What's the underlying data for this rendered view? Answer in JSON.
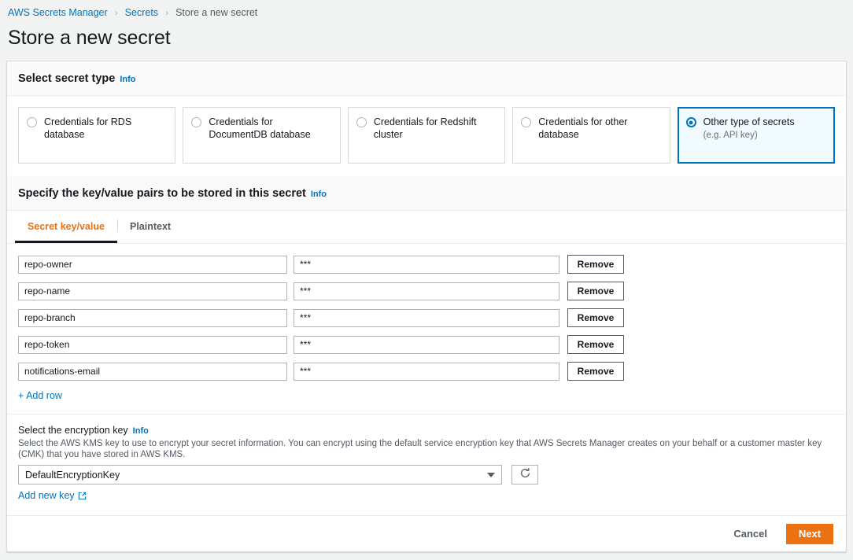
{
  "breadcrumb": {
    "items": [
      {
        "label": "AWS Secrets Manager",
        "current": false
      },
      {
        "label": "Secrets",
        "current": false
      },
      {
        "label": "Store a new secret",
        "current": true
      }
    ],
    "separator": "›"
  },
  "page": {
    "title": "Store a new secret"
  },
  "secret_type": {
    "heading": "Select secret type",
    "info_label": "Info",
    "options": [
      {
        "label": "Credentials for RDS database",
        "sublabel": "",
        "selected": false
      },
      {
        "label": "Credentials for DocumentDB database",
        "sublabel": "",
        "selected": false
      },
      {
        "label": "Credentials for Redshift cluster",
        "sublabel": "",
        "selected": false
      },
      {
        "label": "Credentials for other database",
        "sublabel": "",
        "selected": false
      },
      {
        "label": "Other type of secrets",
        "sublabel": "(e.g. API key)",
        "selected": true
      }
    ]
  },
  "key_value_section": {
    "heading": "Specify the key/value pairs to be stored in this secret",
    "info_label": "Info",
    "tabs": [
      {
        "label": "Secret key/value",
        "active": true
      },
      {
        "label": "Plaintext",
        "active": false
      }
    ],
    "rows": [
      {
        "key": "repo-owner",
        "value": "***",
        "remove_label": "Remove"
      },
      {
        "key": "repo-name",
        "value": "***",
        "remove_label": "Remove"
      },
      {
        "key": "repo-branch",
        "value": "***",
        "remove_label": "Remove"
      },
      {
        "key": "repo-token",
        "value": "***",
        "remove_label": "Remove"
      },
      {
        "key": "notifications-email",
        "value": "***",
        "remove_label": "Remove"
      }
    ],
    "add_row_label": "+ Add row"
  },
  "encryption": {
    "label": "Select the encryption key",
    "info_label": "Info",
    "description": "Select the AWS KMS key to use to encrypt your secret information. You can encrypt using the default service encryption key that AWS Secrets Manager creates on your behalf or a customer master key (CMK) that you have stored in AWS KMS.",
    "selected_key": "DefaultEncryptionKey",
    "add_new_key_label": "Add new key"
  },
  "footer": {
    "cancel_label": "Cancel",
    "next_label": "Next"
  },
  "colors": {
    "accent_orange": "#ec7211",
    "link_blue": "#0073bb",
    "selected_border": "#0073bb",
    "selected_bg": "#f1faff",
    "page_bg": "#f2f3f3",
    "border_gray": "#d5dbdb"
  }
}
